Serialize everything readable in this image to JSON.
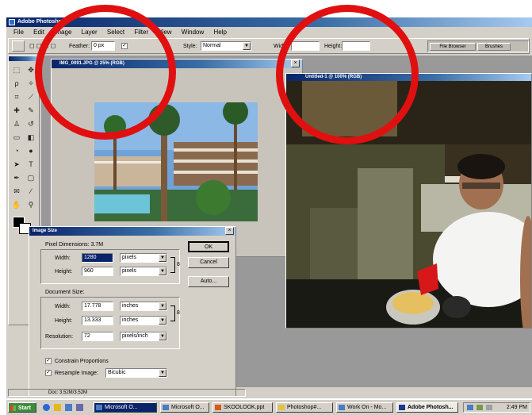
{
  "app": {
    "title": "Adobe Photoshop",
    "menu": [
      "File",
      "Edit",
      "Image",
      "Layer",
      "Select",
      "Filter",
      "View",
      "Window",
      "Help"
    ]
  },
  "options_bar": {
    "feather_label": "Feather:",
    "feather_value": "0 px",
    "style_label": "Style:",
    "style_value": "Normal",
    "width_label": "Width:",
    "height_label": "Height:",
    "tabs": [
      "File Browser",
      "Brushes"
    ]
  },
  "doc1": {
    "title": "IMG_0091.JPG @ 25% (RGB)"
  },
  "doc2": {
    "title": "Untitled-1 @ 100% (RGB)"
  },
  "dialog": {
    "title": "Image Size",
    "pixel_dimensions_label": "Pixel Dimensions: 3.7M",
    "pixel_width_label": "Width:",
    "pixel_width_value": "1280",
    "pixel_width_unit": "pixels",
    "pixel_height_label": "Height:",
    "pixel_height_value": "960",
    "pixel_height_unit": "pixels",
    "document_size_label": "Document Size:",
    "doc_width_label": "Width:",
    "doc_width_value": "17.778",
    "doc_width_unit": "inches",
    "doc_height_label": "Height:",
    "doc_height_value": "13.333",
    "doc_height_unit": "inches",
    "resolution_label": "Resolution:",
    "resolution_value": "72",
    "resolution_unit": "pixels/inch",
    "constrain_label": "Constrain Proportions",
    "resample_label": "Resample Image:",
    "resample_value": "Bicubic",
    "ok_label": "OK",
    "cancel_label": "Cancel",
    "auto_label": "Auto..."
  },
  "status_bar": {
    "doc_info": "Doc: 3.52M/3.52M"
  },
  "taskbar": {
    "start_label": "Start",
    "items": [
      "Microsoft O...",
      "Microsoft O...",
      "SKOOLOOK.ppt",
      "Photoshop#...",
      "Work On - Mo...",
      "Adobe Photosh..."
    ],
    "clock": "2:49 PM"
  },
  "colors": {
    "annotation_circle": "#e01010",
    "titlebar": "#0a246a",
    "chrome": "#d4d0c8"
  }
}
